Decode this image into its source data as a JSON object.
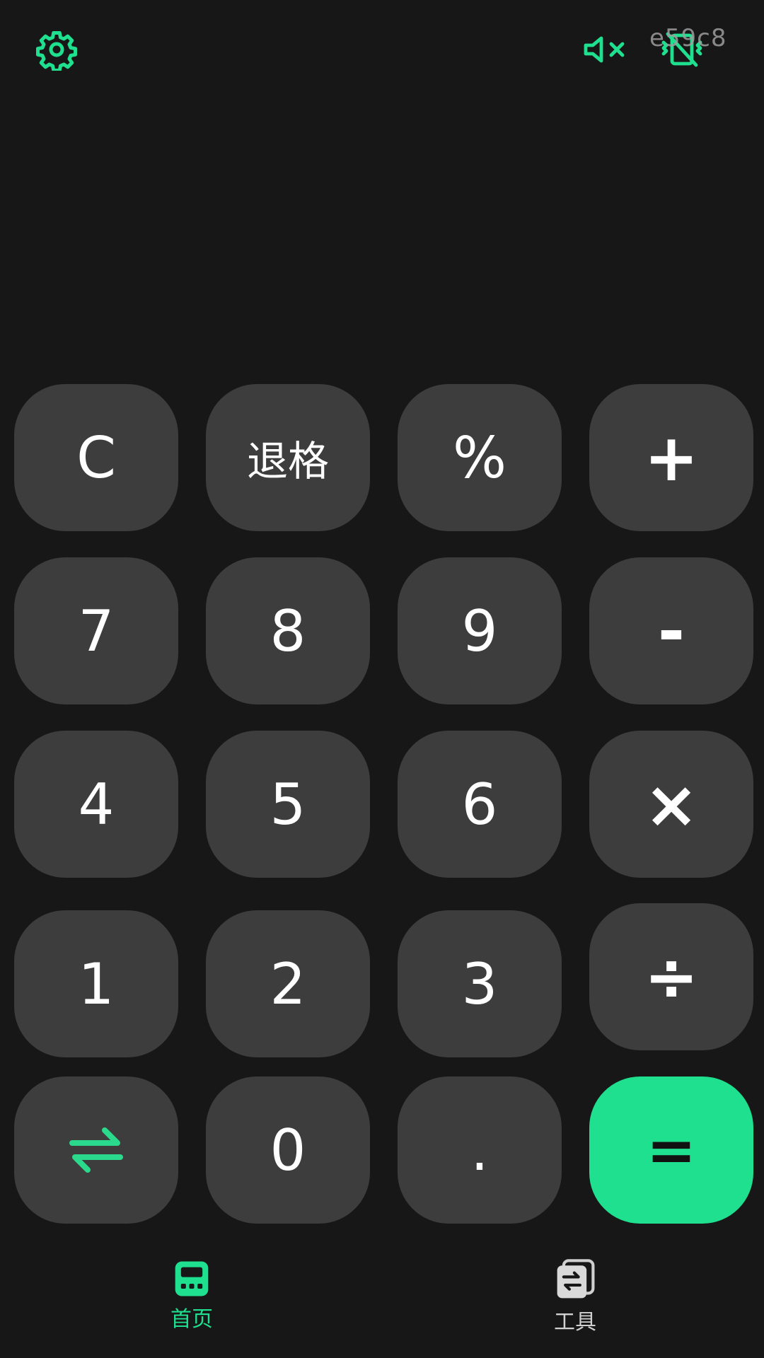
{
  "topbar": {
    "settings_icon": "gear-icon",
    "mute_icon": "speaker-muted-icon",
    "vibrate_icon": "vibration-off-icon",
    "overlay_code": "e59c8",
    "accent_color": "#1ee08f"
  },
  "keypad": {
    "rows": [
      [
        "C",
        "退格",
        "%",
        "+"
      ],
      [
        "7",
        "8",
        "9",
        "-"
      ],
      [
        "4",
        "5",
        "6",
        "×"
      ],
      [
        "1",
        "2",
        "3",
        "÷"
      ],
      [
        "",
        "0",
        ".",
        "="
      ]
    ],
    "swap_icon": "swap-arrows-icon",
    "key_bg": "#3d3d3d",
    "equals_bg": "#1ee08f"
  },
  "bottom_nav": {
    "items": [
      {
        "label": "首页",
        "icon": "calculator-icon",
        "active": true
      },
      {
        "label": "工具",
        "icon": "tools-convert-icon",
        "active": false
      }
    ]
  }
}
